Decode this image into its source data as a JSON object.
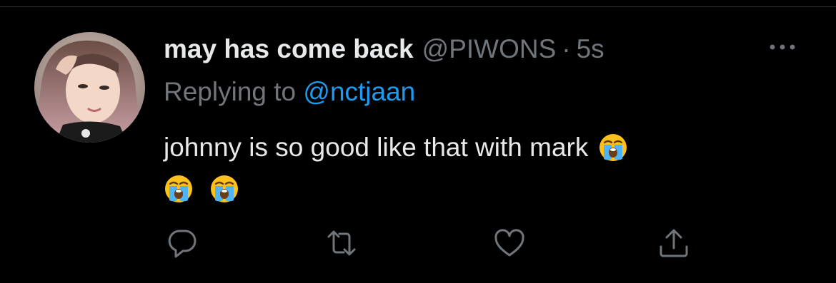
{
  "tweet": {
    "display_name": "may has come back",
    "handle": "@PIWONS",
    "separator": "·",
    "time": "5s",
    "reply_prefix": "Replying to",
    "reply_to": "@nctjaan",
    "text": "johnny is so good like that with mark",
    "emojis": [
      "loudly-crying-face",
      "loudly-crying-face",
      "loudly-crying-face"
    ]
  },
  "actions": [
    {
      "name": "reply",
      "icon": "speech-bubble-icon"
    },
    {
      "name": "retweet",
      "icon": "retweet-arrows-icon"
    },
    {
      "name": "like",
      "icon": "heart-icon"
    },
    {
      "name": "share",
      "icon": "share-upload-icon"
    }
  ],
  "colors": {
    "background": "#000000",
    "primary_text": "#e7e9ea",
    "secondary_text": "#71767b",
    "link": "#1d9bf0",
    "divider": "#2f3336"
  }
}
